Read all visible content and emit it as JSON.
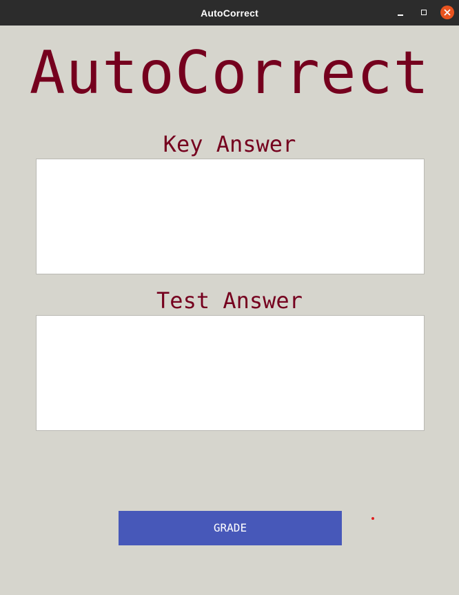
{
  "window": {
    "title": "AutoCorrect",
    "controls": {
      "minimize": "minimize-icon",
      "maximize": "maximize-icon",
      "close": "close-icon"
    }
  },
  "app": {
    "heading": "AutoCorrect",
    "key_answer": {
      "label": "Key Answer",
      "value": "",
      "placeholder": ""
    },
    "test_answer": {
      "label": "Test Answer",
      "value": "",
      "placeholder": ""
    },
    "grade_button_label": "GRADE"
  },
  "colors": {
    "background": "#d6d5cd",
    "accent_text": "#75001e",
    "button": "#4758b9",
    "titlebar": "#2c2c2c",
    "close_button": "#e9541f"
  }
}
